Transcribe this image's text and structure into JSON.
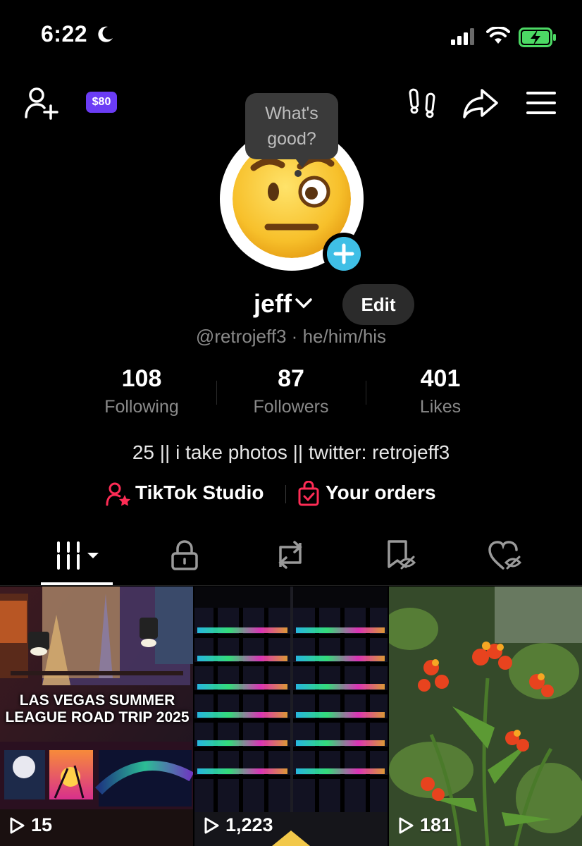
{
  "status_bar": {
    "time": "6:22"
  },
  "header": {
    "balance_badge": "$80"
  },
  "profile": {
    "avatar_prompt": "What's good?",
    "name": "jeff",
    "edit_label": "Edit",
    "handle": "@retrojeff3",
    "pronouns": "he/him/his",
    "stats": [
      {
        "value": "108",
        "label": "Following"
      },
      {
        "value": "87",
        "label": "Followers"
      },
      {
        "value": "401",
        "label": "Likes"
      }
    ],
    "bio": "25 || i take photos || twitter: retrojeff3",
    "links": {
      "studio": "TikTok Studio",
      "orders": "Your orders"
    }
  },
  "tabs": [
    "videos-grid-icon",
    "lock-icon",
    "repost-icon",
    "favorites-icon",
    "liked-icon"
  ],
  "videos": [
    {
      "caption": "LAS VEGAS SUMMER LEAGUE ROAD TRIP 2025",
      "views": "15"
    },
    {
      "caption": "",
      "views": "1,223"
    },
    {
      "caption": "",
      "views": "181"
    }
  ],
  "colors": {
    "accent_cyan": "#3fbfe6",
    "badge_purple": "#6b3cf5",
    "studio_red": "#fe2c55",
    "battery_green": "#4cd964"
  }
}
